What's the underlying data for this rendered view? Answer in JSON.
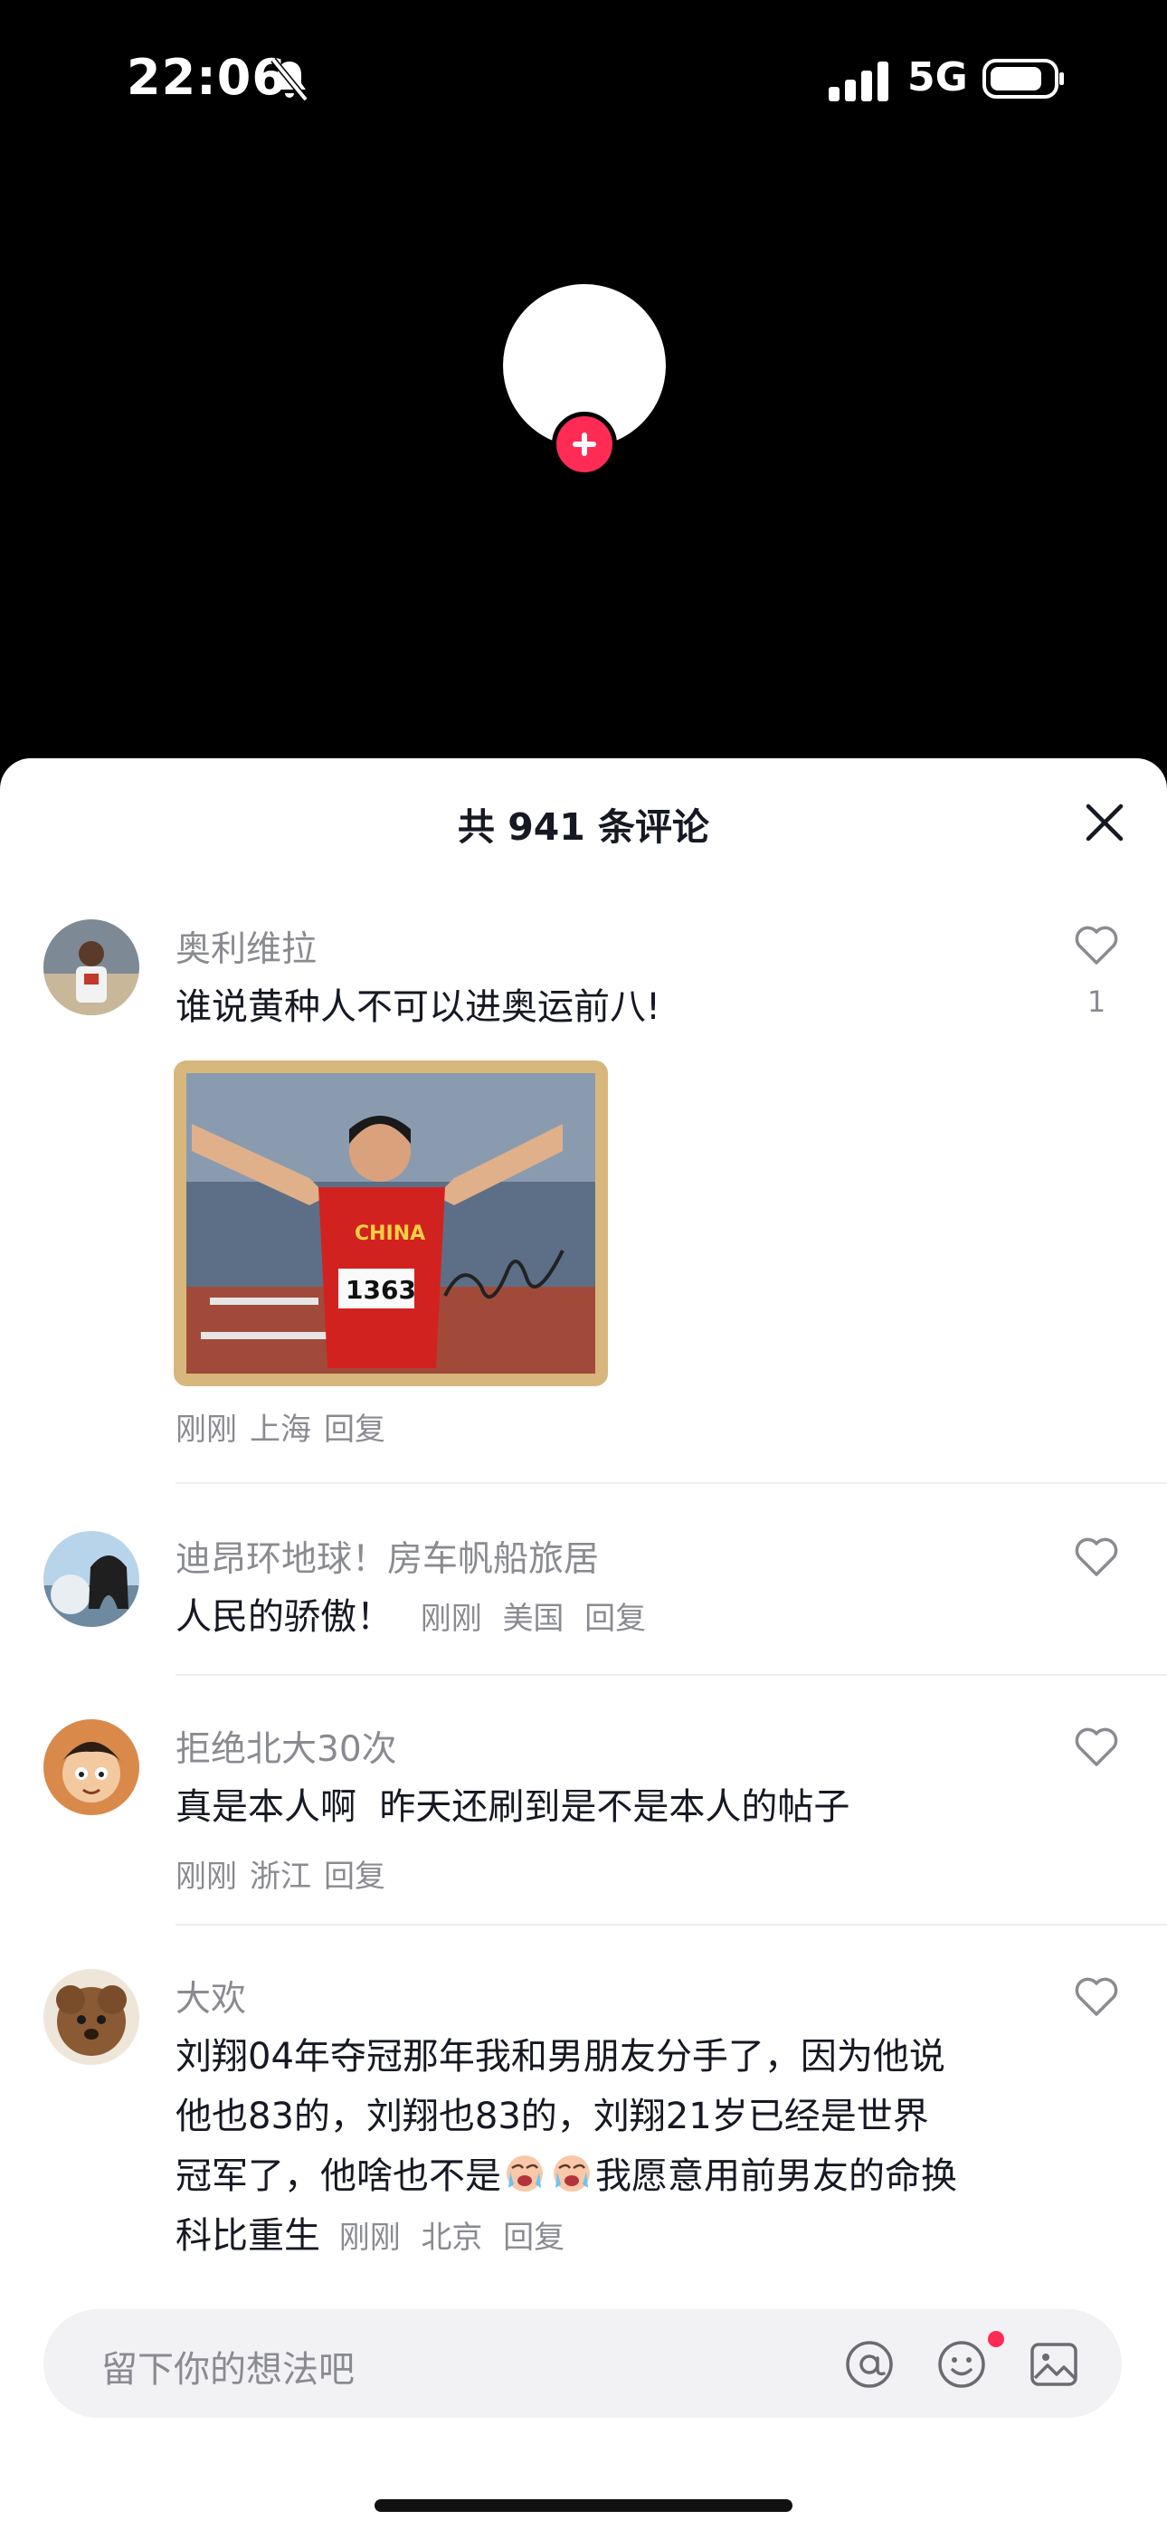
{
  "status_bar": {
    "time": "22:06",
    "network": "5G"
  },
  "sheet": {
    "title": "共 941 条评论"
  },
  "comments": [
    {
      "username": "奥利维拉",
      "text": "谁说黄种人不可以进奥运前八!",
      "meta": {
        "time": "刚刚",
        "location": "上海",
        "reply": "回复"
      },
      "likes": "1",
      "photo": {
        "bib_number": "1363",
        "jersey_text": "CHINA"
      }
    },
    {
      "username": "迪昂环地球！房车帆船旅居",
      "text": "人民的骄傲！",
      "meta": {
        "time": "刚刚",
        "location": "美国",
        "reply": "回复"
      }
    },
    {
      "username": "拒绝北大30次",
      "text": "真是本人啊  昨天还刷到是不是本人的帖子",
      "meta": {
        "time": "刚刚",
        "location": "浙江",
        "reply": "回复"
      }
    },
    {
      "username": "大欢",
      "text_line1": "刘翔04年夺冠那年我和男朋友分手了，因为他说",
      "text_line2": "他也83的，刘翔也83的，刘翔21岁已经是世界",
      "text_line3a": "冠军了，他啥也不是",
      "text_line3b": "我愿意用前男友的命换",
      "text_line4": "科比重生",
      "meta": {
        "time": "刚刚",
        "location": "北京",
        "reply": "回复"
      }
    }
  ],
  "input": {
    "placeholder": "留下你的想法吧"
  },
  "colors": {
    "accent": "#fe2c55",
    "secondary_text": "#8a8b91"
  }
}
